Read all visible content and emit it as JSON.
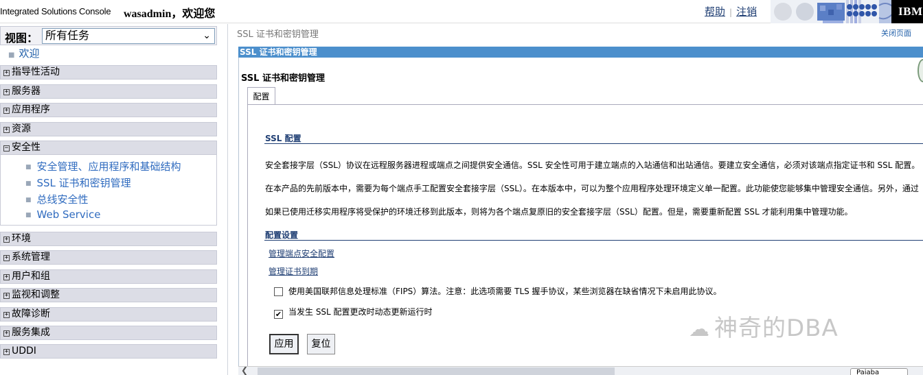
{
  "header": {
    "app_title": "Integrated Solutions Console",
    "welcome": "wasadmin，欢迎您",
    "help": "帮助",
    "logout": "注销",
    "ibm": "IBM"
  },
  "nav": {
    "view_label": "视图：",
    "view_value": "所有任务",
    "welcome": "欢迎",
    "categories": {
      "c0": "指导性活动",
      "c1": "服务器",
      "c2": "应用程序",
      "c3": "资源",
      "c4": "安全性",
      "c5": "环境",
      "c6": "系统管理",
      "c7": "用户和组",
      "c8": "监视和调整",
      "c9": "故障诊断",
      "c10": "服务集成",
      "c11": "UDDI"
    },
    "security_items": {
      "s0": "安全管理、应用程序和基础结构",
      "s1": "SSL 证书和密钥管理",
      "s2": "总线安全性",
      "s3": "Web Service"
    }
  },
  "main": {
    "breadcrumb": "SSL 证书和密钥管理",
    "close_page": "关闭页面",
    "portlet_title": "SSL 证书和密钥管理",
    "heading": "SSL 证书和密钥管理",
    "tab": "配置",
    "ssl_section": "SSL 配置",
    "para1": "安全套接字层（SSL）协议在远程服务器进程或端点之间提供安全通信。SSL 安全性可用于建立端点的入站通信和出站通信。要建立安全通信，必须对该端点指定证书和 SSL 配置。",
    "para2": "在本产品的先前版本中，需要为每个端点手工配置安全套接字层（SSL）。在本版本中，可以为整个应用程序处理环境定义单一配置。此功能使您能够集中管理安全通信。另外，通过",
    "para3": "如果已使用迁移实用程序将受保护的环境迁移到此版本，则将为各个端点复原旧的安全套接字层（SSL）配置。但是，需要重新配置 SSL 才能利用集中管理功能。",
    "settings_section": "配置设置",
    "link1": "管理端点安全配置",
    "link2": "管理证书到期",
    "fips_label": "使用美国联邦信息处理标准（FIPS）算法。注意：此选项需要 TLS 握手协议，某些浏览器在缺省情况下未启用此协议。",
    "dynamic_label": "当发生 SSL 配置更改时动态更新运行时",
    "fips_checked": false,
    "dynamic_checked": true,
    "apply": "应用",
    "reset": "复位"
  },
  "overlay": {
    "watermark": "神奇的DBA",
    "float_btn": "Paiaba"
  }
}
